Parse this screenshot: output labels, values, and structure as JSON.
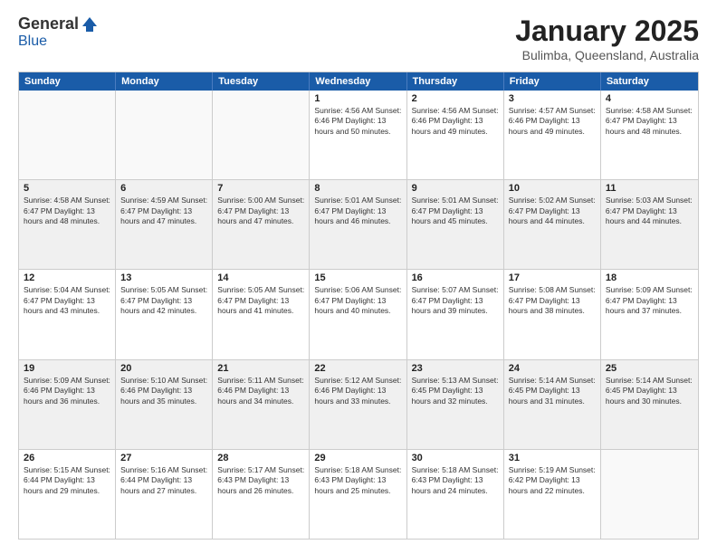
{
  "header": {
    "logo_general": "General",
    "logo_blue": "Blue",
    "month_title": "January 2025",
    "location": "Bulimba, Queensland, Australia"
  },
  "days_of_week": [
    "Sunday",
    "Monday",
    "Tuesday",
    "Wednesday",
    "Thursday",
    "Friday",
    "Saturday"
  ],
  "weeks": [
    [
      {
        "day": "",
        "info": ""
      },
      {
        "day": "",
        "info": ""
      },
      {
        "day": "",
        "info": ""
      },
      {
        "day": "1",
        "info": "Sunrise: 4:56 AM\nSunset: 6:46 PM\nDaylight: 13 hours\nand 50 minutes."
      },
      {
        "day": "2",
        "info": "Sunrise: 4:56 AM\nSunset: 6:46 PM\nDaylight: 13 hours\nand 49 minutes."
      },
      {
        "day": "3",
        "info": "Sunrise: 4:57 AM\nSunset: 6:46 PM\nDaylight: 13 hours\nand 49 minutes."
      },
      {
        "day": "4",
        "info": "Sunrise: 4:58 AM\nSunset: 6:47 PM\nDaylight: 13 hours\nand 48 minutes."
      }
    ],
    [
      {
        "day": "5",
        "info": "Sunrise: 4:58 AM\nSunset: 6:47 PM\nDaylight: 13 hours\nand 48 minutes."
      },
      {
        "day": "6",
        "info": "Sunrise: 4:59 AM\nSunset: 6:47 PM\nDaylight: 13 hours\nand 47 minutes."
      },
      {
        "day": "7",
        "info": "Sunrise: 5:00 AM\nSunset: 6:47 PM\nDaylight: 13 hours\nand 47 minutes."
      },
      {
        "day": "8",
        "info": "Sunrise: 5:01 AM\nSunset: 6:47 PM\nDaylight: 13 hours\nand 46 minutes."
      },
      {
        "day": "9",
        "info": "Sunrise: 5:01 AM\nSunset: 6:47 PM\nDaylight: 13 hours\nand 45 minutes."
      },
      {
        "day": "10",
        "info": "Sunrise: 5:02 AM\nSunset: 6:47 PM\nDaylight: 13 hours\nand 44 minutes."
      },
      {
        "day": "11",
        "info": "Sunrise: 5:03 AM\nSunset: 6:47 PM\nDaylight: 13 hours\nand 44 minutes."
      }
    ],
    [
      {
        "day": "12",
        "info": "Sunrise: 5:04 AM\nSunset: 6:47 PM\nDaylight: 13 hours\nand 43 minutes."
      },
      {
        "day": "13",
        "info": "Sunrise: 5:05 AM\nSunset: 6:47 PM\nDaylight: 13 hours\nand 42 minutes."
      },
      {
        "day": "14",
        "info": "Sunrise: 5:05 AM\nSunset: 6:47 PM\nDaylight: 13 hours\nand 41 minutes."
      },
      {
        "day": "15",
        "info": "Sunrise: 5:06 AM\nSunset: 6:47 PM\nDaylight: 13 hours\nand 40 minutes."
      },
      {
        "day": "16",
        "info": "Sunrise: 5:07 AM\nSunset: 6:47 PM\nDaylight: 13 hours\nand 39 minutes."
      },
      {
        "day": "17",
        "info": "Sunrise: 5:08 AM\nSunset: 6:47 PM\nDaylight: 13 hours\nand 38 minutes."
      },
      {
        "day": "18",
        "info": "Sunrise: 5:09 AM\nSunset: 6:47 PM\nDaylight: 13 hours\nand 37 minutes."
      }
    ],
    [
      {
        "day": "19",
        "info": "Sunrise: 5:09 AM\nSunset: 6:46 PM\nDaylight: 13 hours\nand 36 minutes."
      },
      {
        "day": "20",
        "info": "Sunrise: 5:10 AM\nSunset: 6:46 PM\nDaylight: 13 hours\nand 35 minutes."
      },
      {
        "day": "21",
        "info": "Sunrise: 5:11 AM\nSunset: 6:46 PM\nDaylight: 13 hours\nand 34 minutes."
      },
      {
        "day": "22",
        "info": "Sunrise: 5:12 AM\nSunset: 6:46 PM\nDaylight: 13 hours\nand 33 minutes."
      },
      {
        "day": "23",
        "info": "Sunrise: 5:13 AM\nSunset: 6:45 PM\nDaylight: 13 hours\nand 32 minutes."
      },
      {
        "day": "24",
        "info": "Sunrise: 5:14 AM\nSunset: 6:45 PM\nDaylight: 13 hours\nand 31 minutes."
      },
      {
        "day": "25",
        "info": "Sunrise: 5:14 AM\nSunset: 6:45 PM\nDaylight: 13 hours\nand 30 minutes."
      }
    ],
    [
      {
        "day": "26",
        "info": "Sunrise: 5:15 AM\nSunset: 6:44 PM\nDaylight: 13 hours\nand 29 minutes."
      },
      {
        "day": "27",
        "info": "Sunrise: 5:16 AM\nSunset: 6:44 PM\nDaylight: 13 hours\nand 27 minutes."
      },
      {
        "day": "28",
        "info": "Sunrise: 5:17 AM\nSunset: 6:43 PM\nDaylight: 13 hours\nand 26 minutes."
      },
      {
        "day": "29",
        "info": "Sunrise: 5:18 AM\nSunset: 6:43 PM\nDaylight: 13 hours\nand 25 minutes."
      },
      {
        "day": "30",
        "info": "Sunrise: 5:18 AM\nSunset: 6:43 PM\nDaylight: 13 hours\nand 24 minutes."
      },
      {
        "day": "31",
        "info": "Sunrise: 5:19 AM\nSunset: 6:42 PM\nDaylight: 13 hours\nand 22 minutes."
      },
      {
        "day": "",
        "info": ""
      }
    ]
  ]
}
